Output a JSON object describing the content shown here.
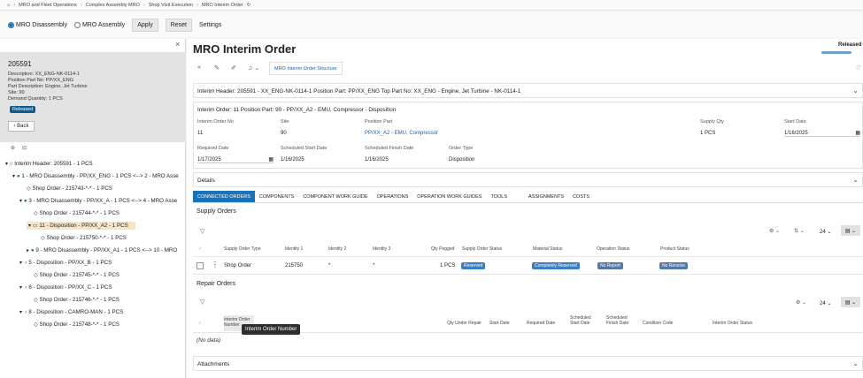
{
  "breadcrumb": [
    "MRO and Fleet Operations",
    "Complex Assembly MRO",
    "Shop Visit Execution",
    "MRO Interim Order"
  ],
  "filter": {
    "opt1": "MRO Disassembly",
    "opt2": "MRO Assembly",
    "apply": "Apply",
    "reset": "Reset",
    "settings": "Settings"
  },
  "header_panel": {
    "id": "205591",
    "lines": [
      "Description:  XX_ENG-NK-0114-1",
      "Position Part No:  PP/XX_ENG",
      "Part Description:  Engine, Jet Turbine",
      "Site:  90",
      "Demand Quantity:  1 PCS"
    ],
    "status": "Released",
    "back": "Back"
  },
  "tree": [
    "Interim Header: 205591 - 1 PCS",
    "1 - MRO Disassembly - PP/XX_ENG - 1 PCS <--> 2 - MRO Asse",
    "Shop Order - 215743-*-* - 1 PCS",
    "3 - MRO Disassembly - PP/XX_A - 1 PCS <--> 4 - MRO Asse",
    "Shop Order - 215744-*-* - 1 PCS",
    "11 - Disposition - PP/XX_A2 - 1 PCS",
    "Shop Order - 215750-*-* - 1 PCS",
    "9 - MRO Disassembly - PP/XX_A1 - 1 PCS <--> 10 - MRO",
    "5 - Disposition - PP/XX_B - 1 PCS",
    "Shop Order - 215745-*-* - 1 PCS",
    "6 - Disposition - PP/XX_C - 1 PCS",
    "Shop Order - 215746-*-* - 1 PCS",
    "8 - Disposition - CAMRO-MAN - 1 PCS",
    "Shop Order - 215748-*-* - 1 PCS"
  ],
  "main": {
    "title": "MRO Interim Order",
    "status": "Released",
    "structure_btn": "MRO Interim Order Structure",
    "interim_header": "Interim Header: 205591 - XX_ENG-NK-0114-1 Position Part: PP/XX_ENG Top Part No: XX_ENG - Engine, Jet Turbine - NK-0114-1",
    "interim_order": "Interim Order: 11 Position Part: 90 - PP/XX_A2 - EMU, Compressor - Disposition",
    "fields": {
      "order_no_l": "Interim Order No",
      "order_no": "11",
      "site_l": "Site",
      "site": "90",
      "pos_part_l": "Position Part",
      "pos_part": "PP/XX_A2 - EMU, Compressor",
      "supply_qty_l": "Supply Qty",
      "supply_qty": "1 PCS",
      "start_date_l": "Start Date",
      "start_date": "1/16/2025",
      "req_date_l": "Required Date",
      "req_date": "1/17/2025",
      "sched_start_l": "Scheduled Start Date",
      "sched_start": "1/16/2025",
      "sched_finish_l": "Scheduled Finish Date",
      "sched_finish": "1/16/2025",
      "order_type_l": "Order Type",
      "order_type": "Disposition"
    },
    "details": "Details",
    "tabs": [
      "CONNECTED ORDERS",
      "COMPONENTS",
      "COMPONENT WORK GUIDE",
      "OPERATIONS",
      "OPERATION WORK GUIDES",
      "TOOLS",
      "ASSIGNMENTS",
      "COSTS"
    ],
    "supply_orders": {
      "title": "Supply Orders",
      "page_size": "24",
      "columns": [
        "Supply Order Type",
        "Identity 1",
        "Identity 2",
        "Identity 3",
        "Qty Pegged",
        "Supply Order Status",
        "Material Status",
        "Operation Status",
        "Product Status"
      ],
      "row": [
        "Shop Order",
        "215750",
        "*",
        "*",
        "1 PCS",
        "Reserved",
        "Completely Reserved",
        "No Report",
        "No Receive"
      ]
    },
    "repair_orders": {
      "title": "Repair Orders",
      "page_size": "24",
      "columns": [
        "Interim Order Number",
        "Qty Under Repair",
        "Start Date",
        "Required Date",
        "Scheduled Start Date",
        "Scheduled Finish Date",
        "Condition Code",
        "Interim Order Status"
      ],
      "nodata": "(No data)",
      "tooltip": "Interim Order Number"
    },
    "attachments": "Attachments"
  }
}
